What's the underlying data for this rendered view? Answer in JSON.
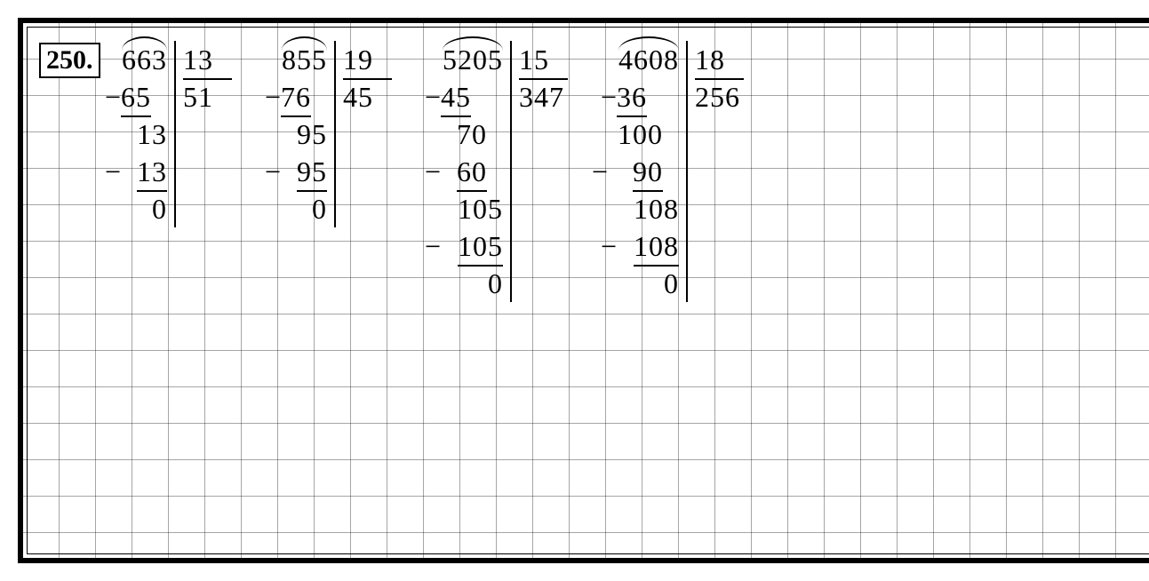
{
  "problem_number": "250.",
  "chart_data": [
    {
      "type": "table",
      "title": "Long division 663 ÷ 13 = 51",
      "dividend": "663",
      "divisor": "13",
      "quotient": "51",
      "steps": [
        "65",
        "13",
        "13",
        "0"
      ],
      "step_prefixes": [
        "−",
        "",
        "−",
        ""
      ]
    },
    {
      "type": "table",
      "title": "Long division 855 ÷ 19 = 45",
      "dividend": "855",
      "divisor": "19",
      "quotient": "45",
      "steps": [
        "76",
        "95",
        "95",
        "0"
      ],
      "step_prefixes": [
        "−",
        "",
        "−",
        ""
      ]
    },
    {
      "type": "table",
      "title": "Long division 5205 ÷ 15 = 347",
      "dividend": "5205",
      "divisor": "15",
      "quotient": "347",
      "steps": [
        "45",
        "70",
        "60",
        "105",
        "105",
        "0"
      ],
      "step_prefixes": [
        "−",
        "",
        "−",
        "",
        "−",
        ""
      ]
    },
    {
      "type": "table",
      "title": "Long division 4608 ÷ 18 = 256",
      "dividend": "4608",
      "divisor": "18",
      "quotient": "256",
      "steps": [
        "36",
        "100",
        "90",
        "108",
        "108",
        "0"
      ],
      "step_prefixes": [
        "−",
        "",
        "−",
        "",
        "−",
        ""
      ]
    }
  ]
}
